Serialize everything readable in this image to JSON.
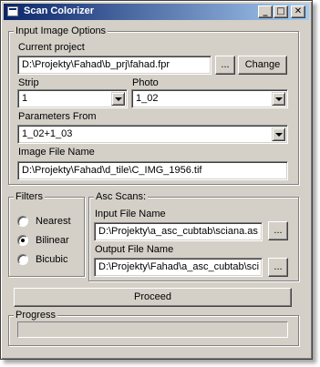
{
  "window": {
    "title": "Scan Colorizer",
    "controls": {
      "minimize": "_",
      "maximize": "□",
      "close": "✕"
    }
  },
  "input_options": {
    "group_label": "Input Image Options",
    "current_project_label": "Current project",
    "current_project_value": "D:\\Projekty\\Fahad\\b_prj\\fahad.fpr",
    "browse_label": "...",
    "change_label": "Change",
    "strip_label": "Strip",
    "strip_value": "1",
    "photo_label": "Photo",
    "photo_value": "1_02",
    "params_from_label": "Parameters From",
    "params_from_value": "1_02+1_03",
    "image_file_label": "Image File Name",
    "image_file_value": "D:\\Projekty\\Fahad\\d_tile\\C_IMG_1956.tif"
  },
  "filters": {
    "group_label": "Filters",
    "options": [
      "Nearest",
      "Bilinear",
      "Bicubic"
    ],
    "selected": "Bilinear"
  },
  "asc_scans": {
    "group_label": "Asc Scans:",
    "input_label": "Input File Name",
    "input_value": "D:\\Projekty\\a_asc_cubtab\\sciana.as",
    "output_label": "Output File Name",
    "output_value": "D:\\Projekty\\Fahad\\a_asc_cubtab\\sci",
    "browse_label": "..."
  },
  "proceed_label": "Proceed",
  "progress": {
    "group_label": "Progress",
    "value": 0
  }
}
